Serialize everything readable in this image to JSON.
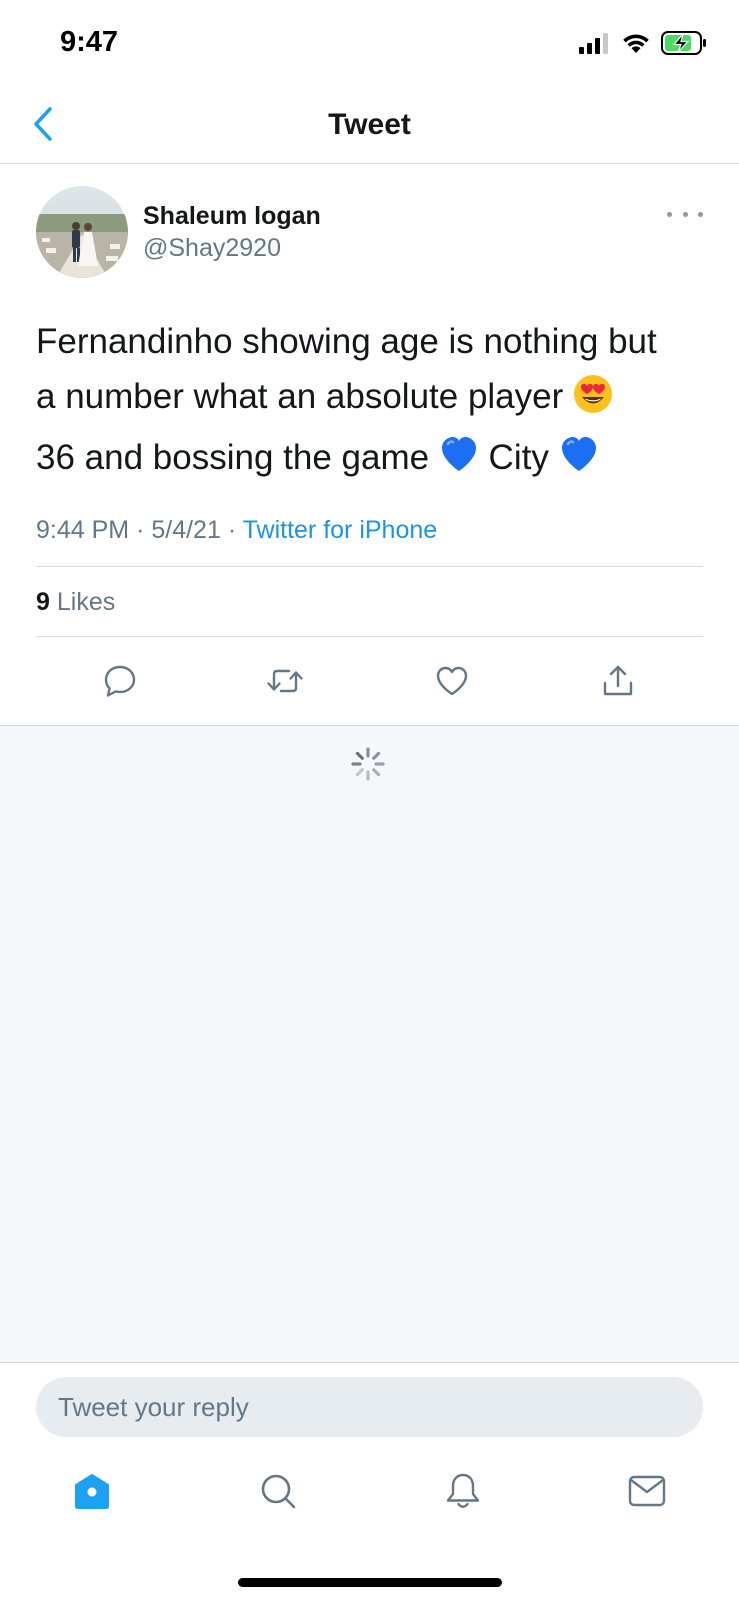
{
  "status_bar": {
    "time": "9:47"
  },
  "nav": {
    "title": "Tweet"
  },
  "tweet": {
    "author_name": "Shaleum logan",
    "author_handle": "@Shay2920",
    "text_lines": [
      "Fernandinho showing age is nothing but",
      "a number what an absolute player",
      "36 and bossing the game",
      "City"
    ],
    "emojis": [
      "smiling-face-with-heart-eyes",
      "blue-heart",
      "blue-heart"
    ],
    "time": "9:44 PM",
    "date": "5/4/21",
    "separator": "·",
    "source": "Twitter for iPhone",
    "likes_count": "9",
    "likes_label": "Likes"
  },
  "reply": {
    "placeholder": "Tweet your reply"
  },
  "icons": {
    "back": "chevron-left-icon",
    "more": "more-horizontal-icon",
    "actions": [
      "reply-icon",
      "retweet-icon",
      "like-icon",
      "share-icon"
    ],
    "tabs": [
      "home-icon",
      "search-icon",
      "notifications-icon",
      "messages-icon"
    ]
  },
  "colors": {
    "accent": "#1DA1F2",
    "link": "#1B95E0",
    "secondary_text": "#657786",
    "feed_background": "#F5F8FA",
    "battery_charging": "#4CD964"
  }
}
